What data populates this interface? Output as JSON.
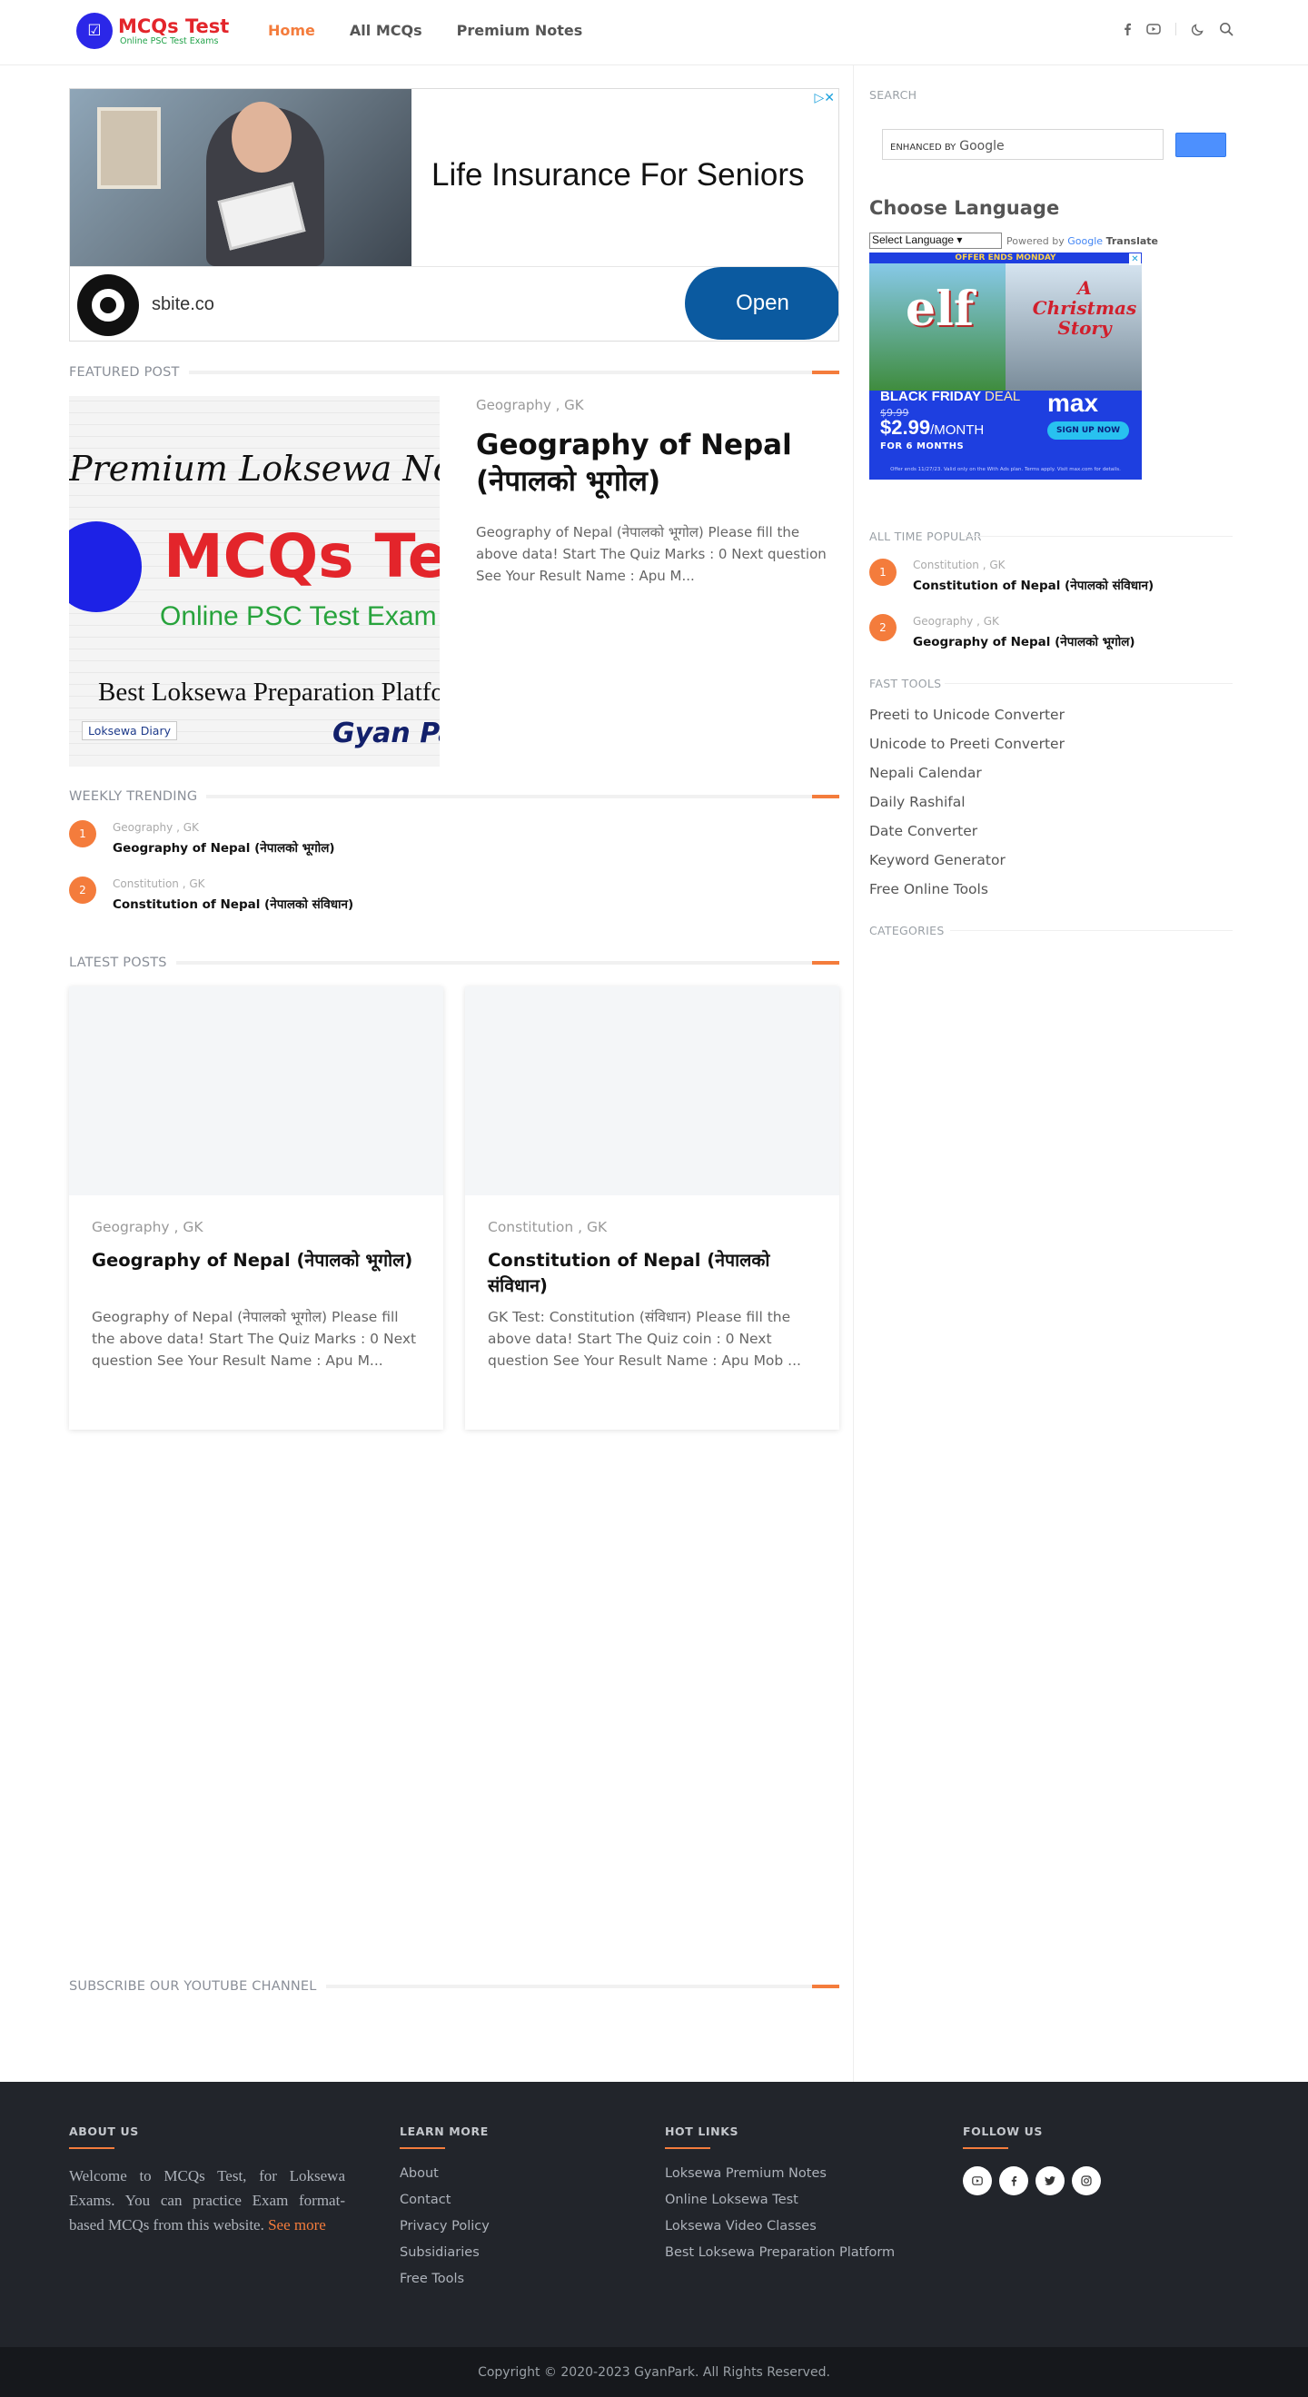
{
  "brand": {
    "title": "MCQs Test",
    "tagline": "Online PSC Test Exams"
  },
  "nav": {
    "items": [
      {
        "label": "Home",
        "active": true
      },
      {
        "label": "All MCQs",
        "active": false
      },
      {
        "label": "Premium Notes",
        "active": false
      }
    ]
  },
  "header_icons": [
    "facebook-icon",
    "youtube-icon",
    "dark-mode-moon-icon",
    "search-icon"
  ],
  "ad_top": {
    "headline": "Life Insurance For Seniors",
    "brand": "sbite.co",
    "cta": "Open",
    "choices_icons": "▷✕"
  },
  "featured": {
    "heading": "FEATURED POST",
    "image": {
      "top_line": "Premium Loksewa Notes",
      "logo_text": "MCQs Test",
      "sub_text": "Online PSC Test Exam",
      "bottom_line": "Best Loksewa Preparation Platfor",
      "left_brand": "Loksewa Diary",
      "right_brand": "Gyan Park"
    },
    "category": "Geography , GK",
    "title": "Geography of Nepal (नेपालको भूगोल)",
    "snippet": "Geography of Nepal (नेपालको भूगोल) Please fill the above data! Start The Quiz Marks :  0 Next question See Your Result Name : Apu M..."
  },
  "weekly": {
    "heading": "WEEKLY TRENDING",
    "items": [
      {
        "rank": "1",
        "category": "Geography , GK",
        "title": "Geography of Nepal (नेपालको भूगोल)"
      },
      {
        "rank": "2",
        "category": "Constitution , GK",
        "title": "Constitution of Nepal (नेपालको संविधान)"
      }
    ]
  },
  "latest": {
    "heading": "LATEST POSTS",
    "cards": [
      {
        "category": "Geography , GK",
        "title": "Geography of Nepal (नेपालको भूगोल)",
        "snippet": "Geography of Nepal (नेपालको भूगोल) Please fill the above data! Start The Quiz Marks :  0 Next question See Your Result Name : Apu M..."
      },
      {
        "category": "Constitution , GK",
        "title": "Constitution of Nepal (नेपालको संविधान)",
        "snippet": "GK Test: Constitution (संविधान) Please fill the above data! Start The Quiz coin :  0 Next question See Your Result Name : Apu Mob ..."
      }
    ]
  },
  "subscribe": {
    "heading": "SUBSCRIBE OUR YOUTUBE CHANNEL"
  },
  "sidebar": {
    "search_label": "SEARCH",
    "search_enhanced": "ENHANCED BY",
    "search_google": "Google",
    "choose_language": "Choose Language",
    "select_language": "Select Language",
    "powered_by": "Powered by",
    "google_word": "Google",
    "translate_word": "Translate",
    "popular_label": "ALL TIME POPULAR",
    "popular": [
      {
        "rank": "1",
        "category": "Constitution , GK",
        "title": "Constitution of Nepal (नेपालको संविधान)"
      },
      {
        "rank": "2",
        "category": "Geography , GK",
        "title": "Geography of Nepal (नेपालको भूगोल)"
      }
    ],
    "tools_label": "FAST TOOLS",
    "tools": [
      "Preeti to Unicode Converter",
      "Unicode to Preeti Converter",
      "Nepali Calendar",
      "Daily Rashifal",
      "Date Converter",
      "Keyword Generator",
      "Free Online Tools"
    ],
    "categories_label": "CATEGORIES"
  },
  "side_ad": {
    "banner": "OFFER ENDS MONDAY",
    "left_title": "elf",
    "right_title": "A Christmas Story",
    "deal_bold": "BLACK FRIDAY",
    "deal_word": "DEAL",
    "was": "$9.99",
    "price": "$2.99",
    "per": "/MONTH",
    "term": "FOR 6 MONTHS",
    "brand": "max",
    "cta": "SIGN UP NOW",
    "fine": "Offer ends 11/27/23. Valid only on the With Ads plan. Terms apply. Visit max.com for details."
  },
  "footer": {
    "about_h": "ABOUT US",
    "about_text": "Welcome to MCQs Test, for Loksewa Exams. You can practice Exam format-based MCQs from this website.",
    "see_more": "See more",
    "learn_h": "LEARN MORE",
    "learn": [
      "About",
      "Contact",
      "Privacy Policy",
      "Subsidiaries",
      "Free Tools"
    ],
    "hot_h": "HOT LINKS",
    "hot": [
      "Loksewa Premium Notes",
      "Online Loksewa Test",
      "Loksewa Video Classes",
      "Best Loksewa Preparation Platform"
    ],
    "follow_h": "FOLLOW US",
    "social_icons": [
      "youtube-icon",
      "facebook-icon",
      "twitter-icon",
      "instagram-icon"
    ],
    "copyright": "Copyright © 2020-2023 GyanPark. All Rights Reserved."
  },
  "colors": {
    "accent": "#f47c3c",
    "footer_bg": "#22252b",
    "brand_red": "#e3252b",
    "brand_blue": "#2b27e8"
  }
}
